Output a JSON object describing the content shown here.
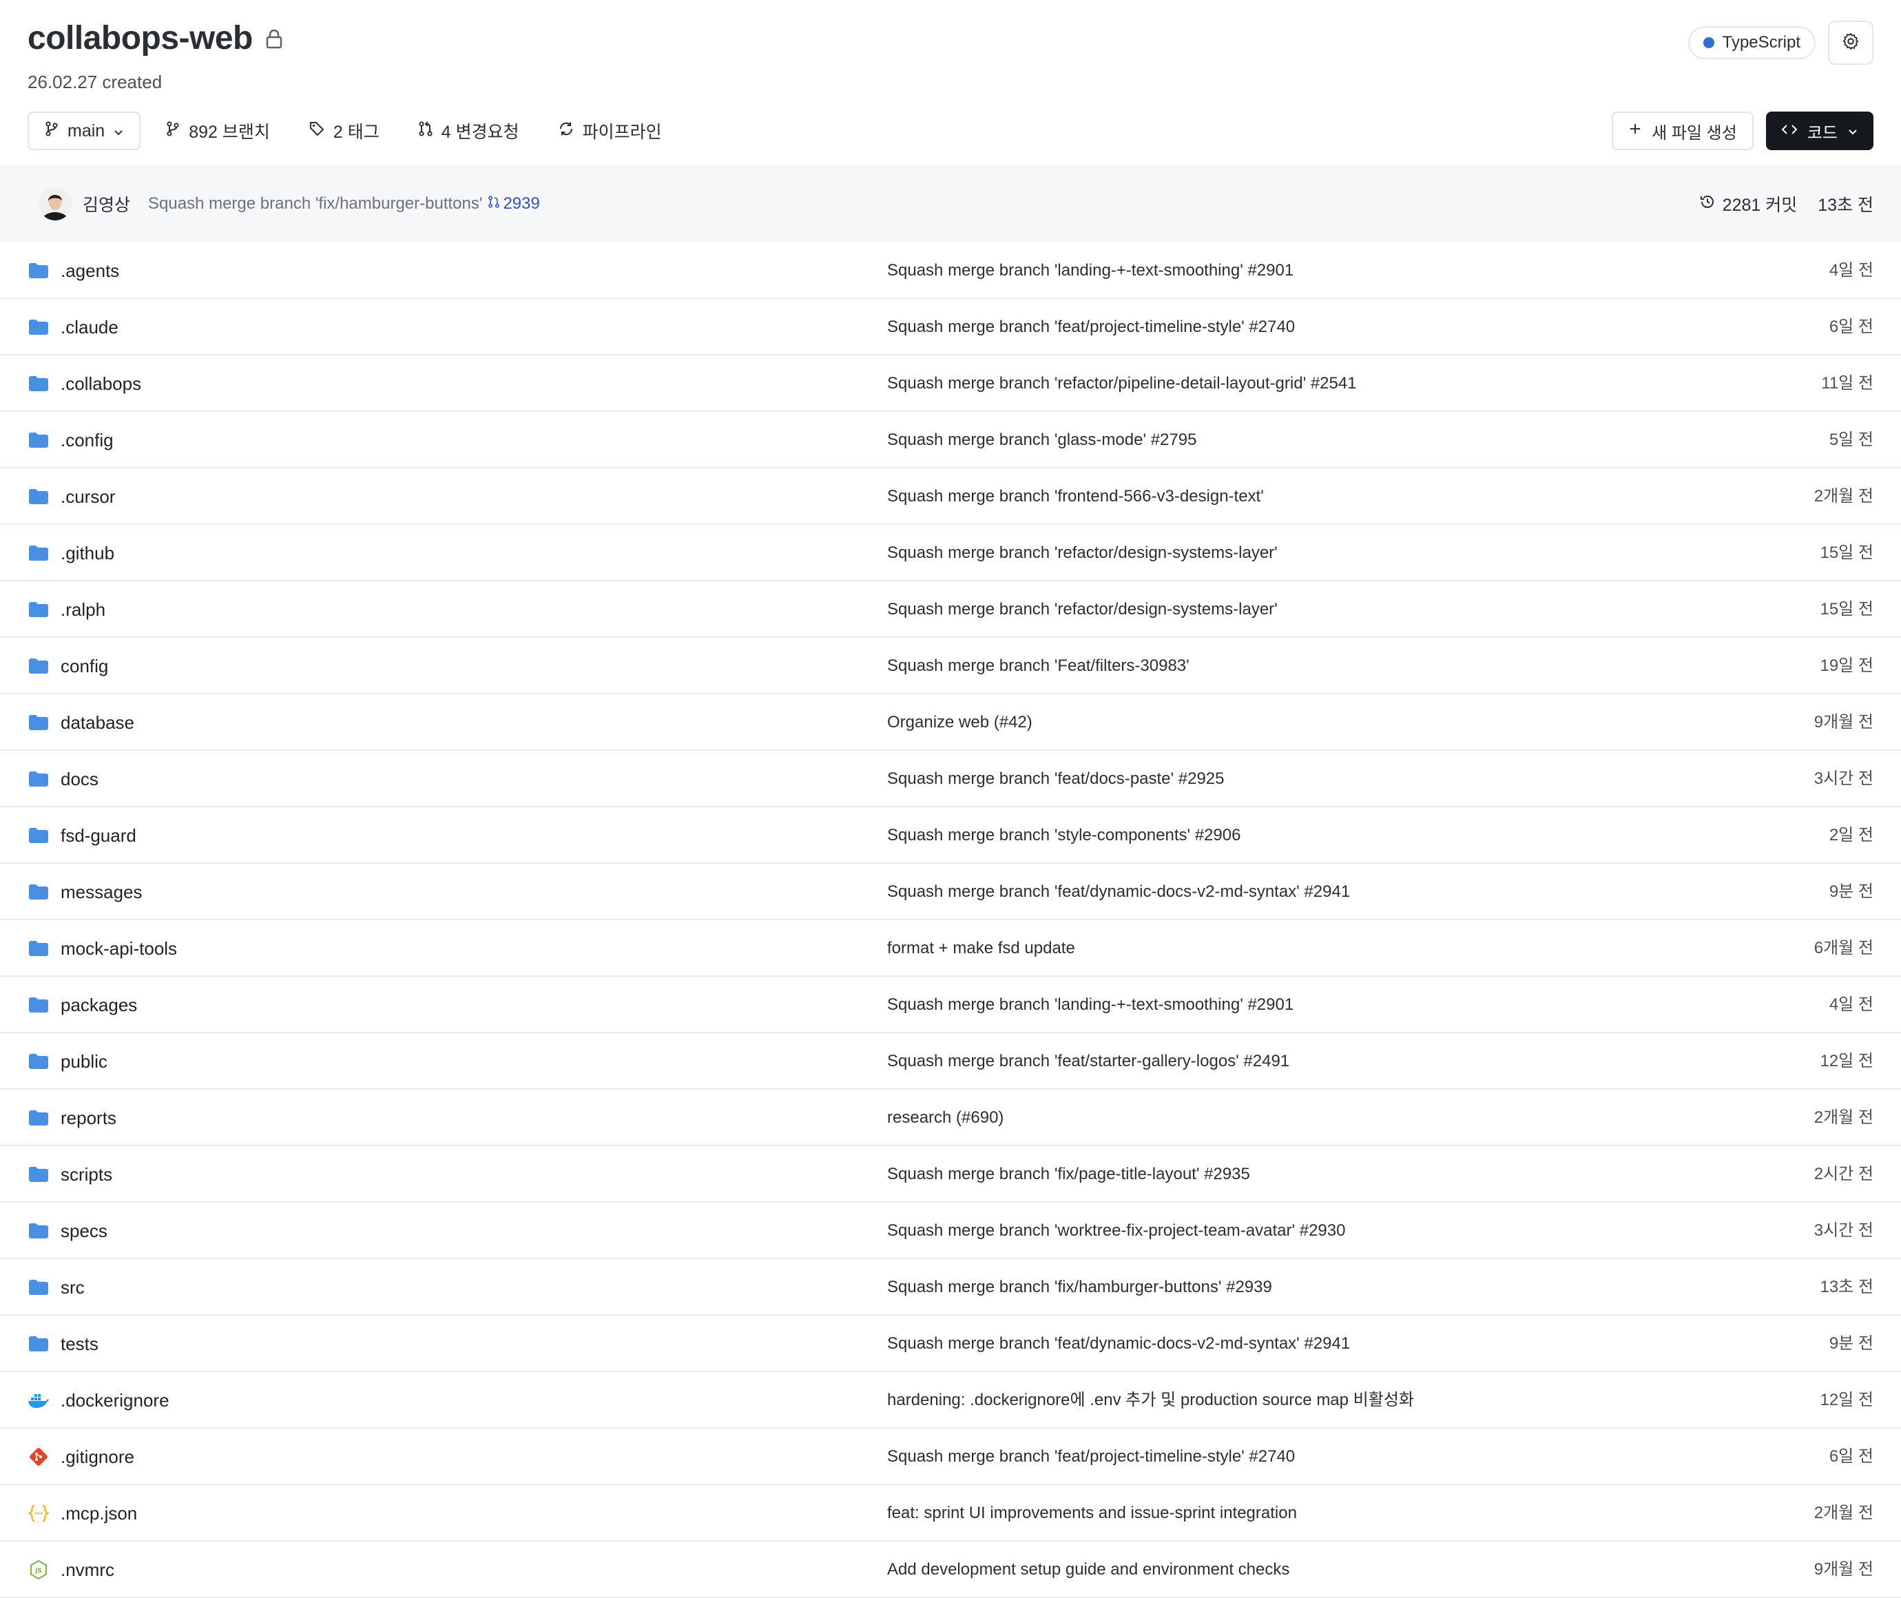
{
  "repo": {
    "name": "collabops-web",
    "created": "26.02.27 created",
    "language": "TypeScript",
    "language_color": "#2f6fd1"
  },
  "toolbar": {
    "branch": "main",
    "branches": "892 브랜치",
    "tags": "2 태그",
    "change_requests": "4 변경요청",
    "pipeline": "파이프라인",
    "new_file": "새 파일 생성",
    "code": "코드"
  },
  "latest_commit": {
    "author": "김영상",
    "message": "Squash merge branch 'fix/hamburger-buttons'",
    "pr_number": "2939",
    "commit_count": "2281 커밋",
    "time": "13초 전"
  },
  "colors": {
    "folder": "#4a90e2",
    "docker": "#2496ed",
    "git": "#e24329",
    "json": "#f0b429",
    "node": "#7cb342"
  },
  "files": [
    {
      "name": ".agents",
      "type": "folder",
      "icon": "folder-icon",
      "commit": "Squash merge branch 'landing-+-text-smoothing' #2901",
      "time": "4일 전"
    },
    {
      "name": ".claude",
      "type": "folder",
      "icon": "folder-icon",
      "commit": "Squash merge branch 'feat/project-timeline-style' #2740",
      "time": "6일 전"
    },
    {
      "name": ".collabops",
      "type": "folder",
      "icon": "folder-icon",
      "commit": "Squash merge branch 'refactor/pipeline-detail-layout-grid' #2541",
      "time": "11일 전"
    },
    {
      "name": ".config",
      "type": "folder",
      "icon": "folder-icon",
      "commit": "Squash merge branch 'glass-mode' #2795",
      "time": "5일 전"
    },
    {
      "name": ".cursor",
      "type": "folder",
      "icon": "folder-icon",
      "commit": "Squash merge branch 'frontend-566-v3-design-text'",
      "time": "2개월 전"
    },
    {
      "name": ".github",
      "type": "folder",
      "icon": "folder-icon",
      "commit": "Squash merge branch 'refactor/design-systems-layer'",
      "time": "15일 전"
    },
    {
      "name": ".ralph",
      "type": "folder",
      "icon": "folder-icon",
      "commit": "Squash merge branch 'refactor/design-systems-layer'",
      "time": "15일 전"
    },
    {
      "name": "config",
      "type": "folder",
      "icon": "folder-icon",
      "commit": "Squash merge branch 'Feat/filters-30983'",
      "time": "19일 전"
    },
    {
      "name": "database",
      "type": "folder",
      "icon": "folder-icon",
      "commit": "Organize web (#42)",
      "time": "9개월 전"
    },
    {
      "name": "docs",
      "type": "folder",
      "icon": "folder-icon",
      "commit": "Squash merge branch 'feat/docs-paste' #2925",
      "time": "3시간 전"
    },
    {
      "name": "fsd-guard",
      "type": "folder",
      "icon": "folder-icon",
      "commit": "Squash merge branch 'style-components' #2906",
      "time": "2일 전"
    },
    {
      "name": "messages",
      "type": "folder",
      "icon": "folder-icon",
      "commit": "Squash merge branch 'feat/dynamic-docs-v2-md-syntax' #2941",
      "time": "9분 전"
    },
    {
      "name": "mock-api-tools",
      "type": "folder",
      "icon": "folder-icon",
      "commit": "format + make fsd update",
      "time": "6개월 전"
    },
    {
      "name": "packages",
      "type": "folder",
      "icon": "folder-icon",
      "commit": "Squash merge branch 'landing-+-text-smoothing' #2901",
      "time": "4일 전"
    },
    {
      "name": "public",
      "type": "folder",
      "icon": "folder-icon",
      "commit": "Squash merge branch 'feat/starter-gallery-logos' #2491",
      "time": "12일 전"
    },
    {
      "name": "reports",
      "type": "folder",
      "icon": "folder-icon",
      "commit": "research (#690)",
      "time": "2개월 전"
    },
    {
      "name": "scripts",
      "type": "folder",
      "icon": "folder-icon",
      "commit": "Squash merge branch 'fix/page-title-layout' #2935",
      "time": "2시간 전"
    },
    {
      "name": "specs",
      "type": "folder",
      "icon": "folder-icon",
      "commit": "Squash merge branch 'worktree-fix-project-team-avatar' #2930",
      "time": "3시간 전"
    },
    {
      "name": "src",
      "type": "folder",
      "icon": "folder-icon",
      "commit": "Squash merge branch 'fix/hamburger-buttons' #2939",
      "time": "13초 전"
    },
    {
      "name": "tests",
      "type": "folder",
      "icon": "folder-icon",
      "commit": "Squash merge branch 'feat/dynamic-docs-v2-md-syntax' #2941",
      "time": "9분 전"
    },
    {
      "name": ".dockerignore",
      "type": "docker",
      "icon": "docker-icon",
      "commit": "hardening: .dockerignore에 .env 추가 및 production source map 비활성화",
      "time": "12일 전"
    },
    {
      "name": ".gitignore",
      "type": "git",
      "icon": "git-icon",
      "commit": "Squash merge branch 'feat/project-timeline-style' #2740",
      "time": "6일 전"
    },
    {
      "name": ".mcp.json",
      "type": "json",
      "icon": "json-icon",
      "commit": "feat: sprint UI improvements and issue-sprint integration",
      "time": "2개월 전"
    },
    {
      "name": ".nvmrc",
      "type": "node",
      "icon": "nodejs-icon",
      "commit": "Add development setup guide and environment checks",
      "time": "9개월 전"
    }
  ]
}
